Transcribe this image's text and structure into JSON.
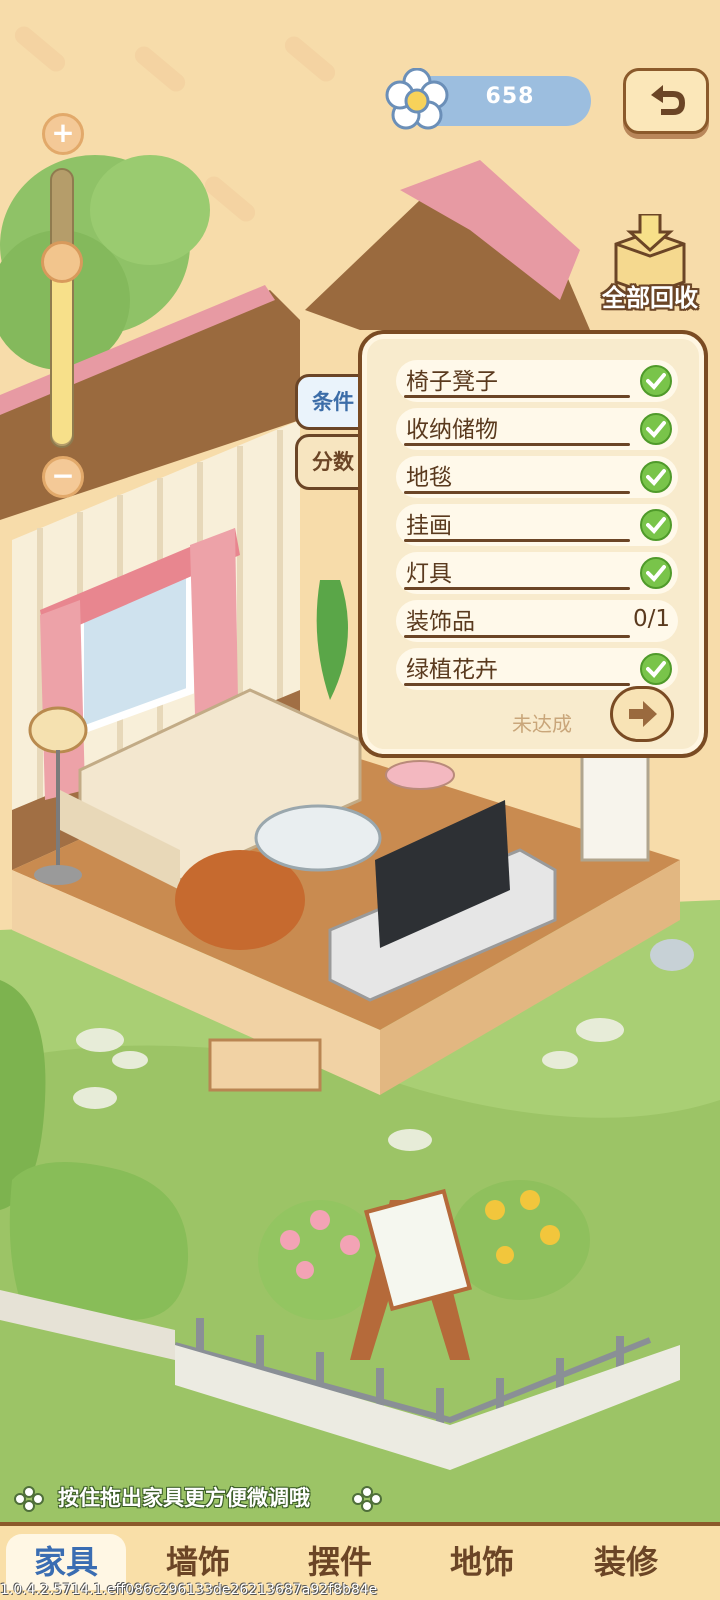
{
  "currency": {
    "icon": "flower-icon",
    "value": "658"
  },
  "top_actions": {
    "recycle_all_label": "全部回收",
    "back_icon": "back-arrow-icon"
  },
  "zoom": {
    "plus": "+",
    "minus": "−",
    "level": 0.65
  },
  "side_tabs": [
    {
      "label": "条件",
      "active": true
    },
    {
      "label": "分数",
      "active": false
    }
  ],
  "conditions": [
    {
      "name": "椅子凳子",
      "done": true
    },
    {
      "name": "收纳储物",
      "done": true
    },
    {
      "name": "地毯",
      "done": true
    },
    {
      "name": "挂画",
      "done": true
    },
    {
      "name": "灯具",
      "done": true
    },
    {
      "name": "装饰品",
      "done": false,
      "progress": "0/1"
    },
    {
      "name": "绿植花卉",
      "done": true
    }
  ],
  "panel_status": "未达成",
  "hint": "按住拖出家具更方便微调哦",
  "bottom_nav": [
    {
      "label": "家具",
      "active": true
    },
    {
      "label": "墙饰",
      "active": false
    },
    {
      "label": "摆件",
      "active": false
    },
    {
      "label": "地饰",
      "active": false
    },
    {
      "label": "装修",
      "active": false
    }
  ],
  "version": "1.0.4.2.5714.1.eff086c296133de26213687a92f8b84e",
  "colors": {
    "background": "#f7dcaa",
    "grass": "#a9cf74",
    "accent_blue": "#3a6db2",
    "brown": "#6b4526",
    "check_green": "#79c44a"
  }
}
